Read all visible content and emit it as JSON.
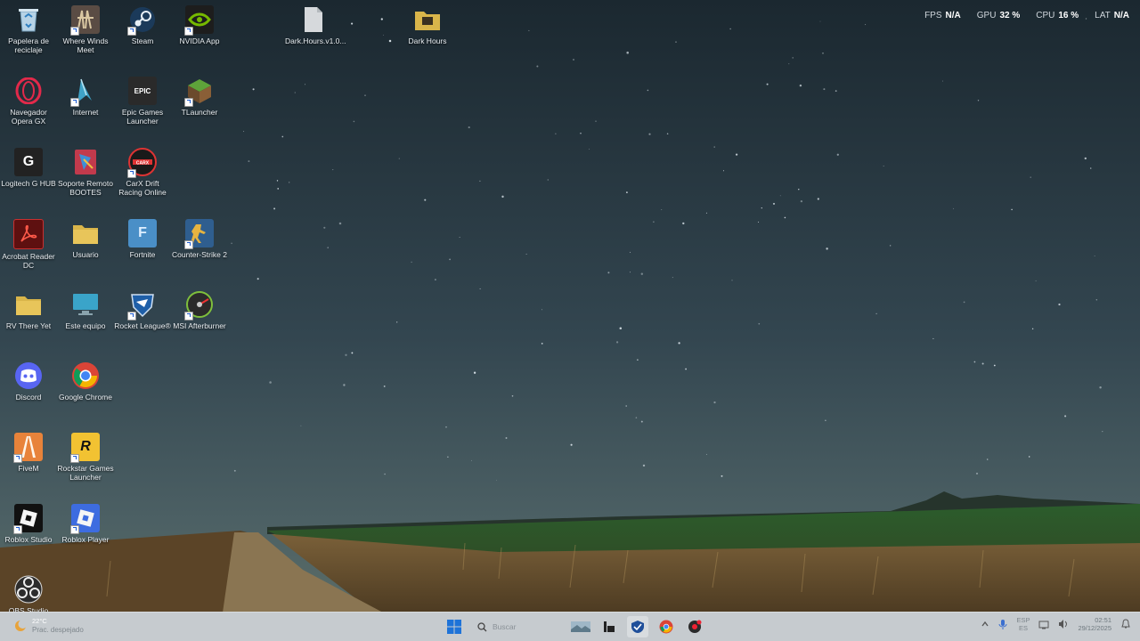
{
  "perf": {
    "fps_label": "FPS",
    "fps_value": "N/A",
    "gpu_label": "GPU",
    "gpu_value": "32 %",
    "cpu_label": "CPU",
    "cpu_value": "16 %",
    "lat_label": "LAT",
    "lat_value": "N/A"
  },
  "desktop": {
    "icons": [
      {
        "label": "Papelera de reciclaje",
        "icon": "recycle-bin-icon"
      },
      {
        "label": "Where Winds Meet",
        "icon": "where-winds-meet-icon"
      },
      {
        "label": "Steam",
        "icon": "steam-icon"
      },
      {
        "label": "NVIDIA App",
        "icon": "nvidia-icon"
      },
      {
        "label": "Dark.Hours.v1.0...",
        "icon": "file-icon"
      },
      {
        "label": "Dark Hours",
        "icon": "folder-icon"
      },
      {
        "label": "Navegador Opera GX",
        "icon": "opera-gx-icon"
      },
      {
        "label": "Internet",
        "icon": "internet-icon"
      },
      {
        "label": "Epic Games Launcher",
        "icon": "epic-games-icon",
        "glyph_text": "EPIC"
      },
      {
        "label": "TLauncher",
        "icon": "tlauncher-icon"
      },
      {
        "label": "Logitech G HUB",
        "icon": "logitech-g-hub-icon",
        "glyph_text": "G"
      },
      {
        "label": "Soporte Remoto BOOTES",
        "icon": "remote-support-icon"
      },
      {
        "label": "CarX Drift Racing Online",
        "icon": "carx-icon"
      },
      {
        "label": "Acrobat Reader DC",
        "icon": "acrobat-reader-icon"
      },
      {
        "label": "Usuario",
        "icon": "folder-icon"
      },
      {
        "label": "Fortnite",
        "icon": "fortnite-icon",
        "glyph_text": "F"
      },
      {
        "label": "Counter-Strike 2",
        "icon": "counter-strike-icon"
      },
      {
        "label": "RV There Yet",
        "icon": "folder-icon"
      },
      {
        "label": "Este equipo",
        "icon": "this-pc-icon"
      },
      {
        "label": "Rocket League®",
        "icon": "rocket-league-icon"
      },
      {
        "label": "MSI Afterburner",
        "icon": "msi-afterburner-icon"
      },
      {
        "label": "Discord",
        "icon": "discord-icon"
      },
      {
        "label": "Google Chrome",
        "icon": "chrome-icon"
      },
      {
        "label": "FiveM",
        "icon": "fivem-icon"
      },
      {
        "label": "Rockstar Games Launcher",
        "icon": "rockstar-icon",
        "glyph_text": "R"
      },
      {
        "label": "Roblox Studio",
        "icon": "roblox-studio-icon"
      },
      {
        "label": "Roblox Player",
        "icon": "roblox-player-icon"
      },
      {
        "label": "OBS Studio",
        "icon": "obs-studio-icon"
      }
    ]
  },
  "taskbar": {
    "weather_temp": "22°C",
    "weather_condition": "Prac. despejado",
    "search_placeholder": "Buscar",
    "lang_top": "ESP",
    "lang_bottom": "ES",
    "time": "02:51",
    "date": "29/12/2025"
  },
  "colors": {
    "taskbar": "#c6cbcf",
    "sky_top": "#1c2a33",
    "sky_horizon": "#4d6266",
    "field": "#2f5a2c",
    "grass": "#8a6a3f"
  }
}
